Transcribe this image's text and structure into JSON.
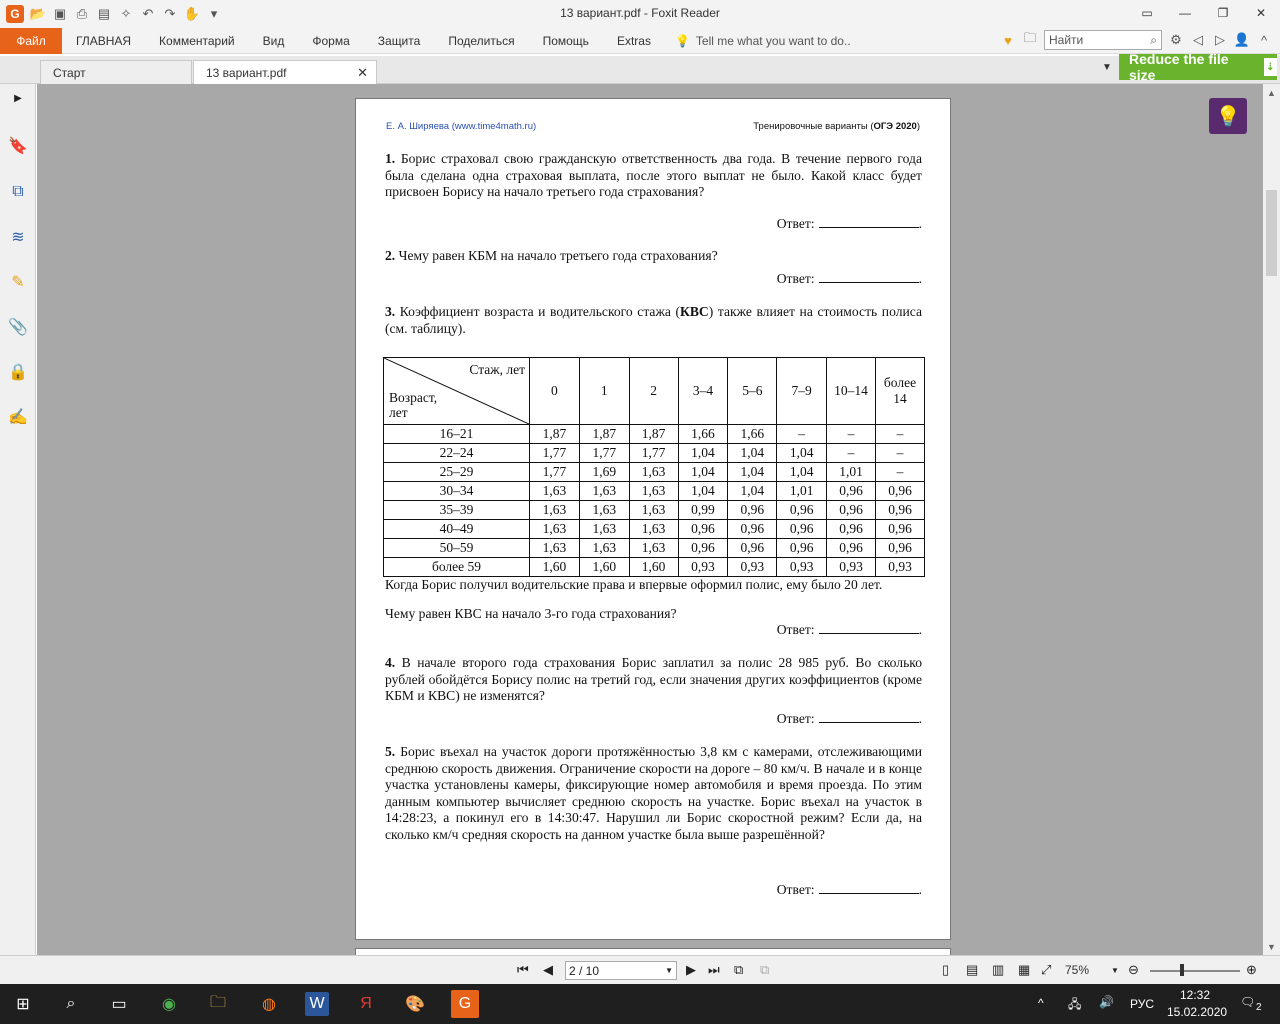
{
  "window": {
    "title": "13 вариант.pdf - Foxit Reader"
  },
  "ribbon": {
    "file": "Файл",
    "menu": [
      "ГЛАВНАЯ",
      "Комментарий",
      "Вид",
      "Форма",
      "Защита",
      "Поделиться",
      "Помощь",
      "Extras"
    ],
    "tellme": "Tell me what you want to do..",
    "search_placeholder": "Найти"
  },
  "tabs": [
    {
      "label": "Старт"
    },
    {
      "label": "13 вариант.pdf"
    }
  ],
  "reduce_button": "Reduce the file size",
  "page": {
    "header_left": "Е. А. Ширяева (www.time4math.ru)",
    "header_right_prefix": "Тренировочные варианты (",
    "header_right_bold": "ОГЭ 2020",
    "header_right_suffix": ")",
    "answer_label": "Ответ:",
    "task1_num": "1.",
    "task1_text": "Борис страховал свою гражданскую ответственность два года. В течение первого года была сделана одна страховая выплата, после этого выплат не было. Какой класс будет присвоен Борису на начало третьего года страхования?",
    "task2_num": "2.",
    "task2_text": "Чему равен КБМ на начало третьего года страхования?",
    "task3_num": "3.",
    "task3_text_a": "Коэффициент возраста и водительского стажа (",
    "task3_text_bold": "КВС",
    "task3_text_b": ") также влияет на стоимость полиса (см. таблицу).",
    "table": {
      "corner_top": "Стаж, лет",
      "corner_bottom": "Возраст, лет",
      "columns": [
        "0",
        "1",
        "2",
        "3–4",
        "5–6",
        "7–9",
        "10–14",
        "более 14"
      ],
      "rows": [
        {
          "age": "16–21",
          "values": [
            "1,87",
            "1,87",
            "1,87",
            "1,66",
            "1,66",
            "–",
            "–",
            "–"
          ]
        },
        {
          "age": "22–24",
          "values": [
            "1,77",
            "1,77",
            "1,77",
            "1,04",
            "1,04",
            "1,04",
            "–",
            "–"
          ]
        },
        {
          "age": "25–29",
          "values": [
            "1,77",
            "1,69",
            "1,63",
            "1,04",
            "1,04",
            "1,04",
            "1,01",
            "–"
          ]
        },
        {
          "age": "30–34",
          "values": [
            "1,63",
            "1,63",
            "1,63",
            "1,04",
            "1,04",
            "1,01",
            "0,96",
            "0,96"
          ]
        },
        {
          "age": "35–39",
          "values": [
            "1,63",
            "1,63",
            "1,63",
            "0,99",
            "0,96",
            "0,96",
            "0,96",
            "0,96"
          ]
        },
        {
          "age": "40–49",
          "values": [
            "1,63",
            "1,63",
            "1,63",
            "0,96",
            "0,96",
            "0,96",
            "0,96",
            "0,96"
          ]
        },
        {
          "age": "50–59",
          "values": [
            "1,63",
            "1,63",
            "1,63",
            "0,96",
            "0,96",
            "0,96",
            "0,96",
            "0,96"
          ]
        },
        {
          "age": "более 59",
          "values": [
            "1,60",
            "1,60",
            "1,60",
            "0,93",
            "0,93",
            "0,93",
            "0,93",
            "0,93"
          ]
        }
      ]
    },
    "task3_after": "Когда Борис получил водительские права и впервые оформил полис, ему было 20 лет.",
    "task3_question": "Чему равен КВС на начало 3-го года страхования?",
    "task4_num": "4.",
    "task4_text": "В начале второго года страхования Борис заплатил за полис 28 985 руб. Во сколько рублей обойдётся Борису полис на третий год, если значения других коэффициентов (кроме КБМ и КВС) не изменятся?",
    "task5_num": "5.",
    "task5_text": "Борис въехал на участок дороги протяжённостью 3,8 км с камерами, отслеживающими среднюю скорость движения. Ограничение скорости на дороге – 80 км/ч. В начале и в конце участка установлены камеры, фиксирующие номер автомобиля и время проезда. По этим данным компьютер вычисляет среднюю скорость на участке. Борис въехал на участок в 14:28:23, а покинул его в 14:30:47. Нарушил ли Борис скоростной режим? Если да, на сколько км/ч средняя скорость на данном участке была выше разрешённой?"
  },
  "status": {
    "page_field": "2 / 10",
    "zoom": "75%"
  },
  "taskbar": {
    "lang": "РУС",
    "time": "12:32",
    "date": "15.02.2020",
    "notif_count": "2"
  }
}
